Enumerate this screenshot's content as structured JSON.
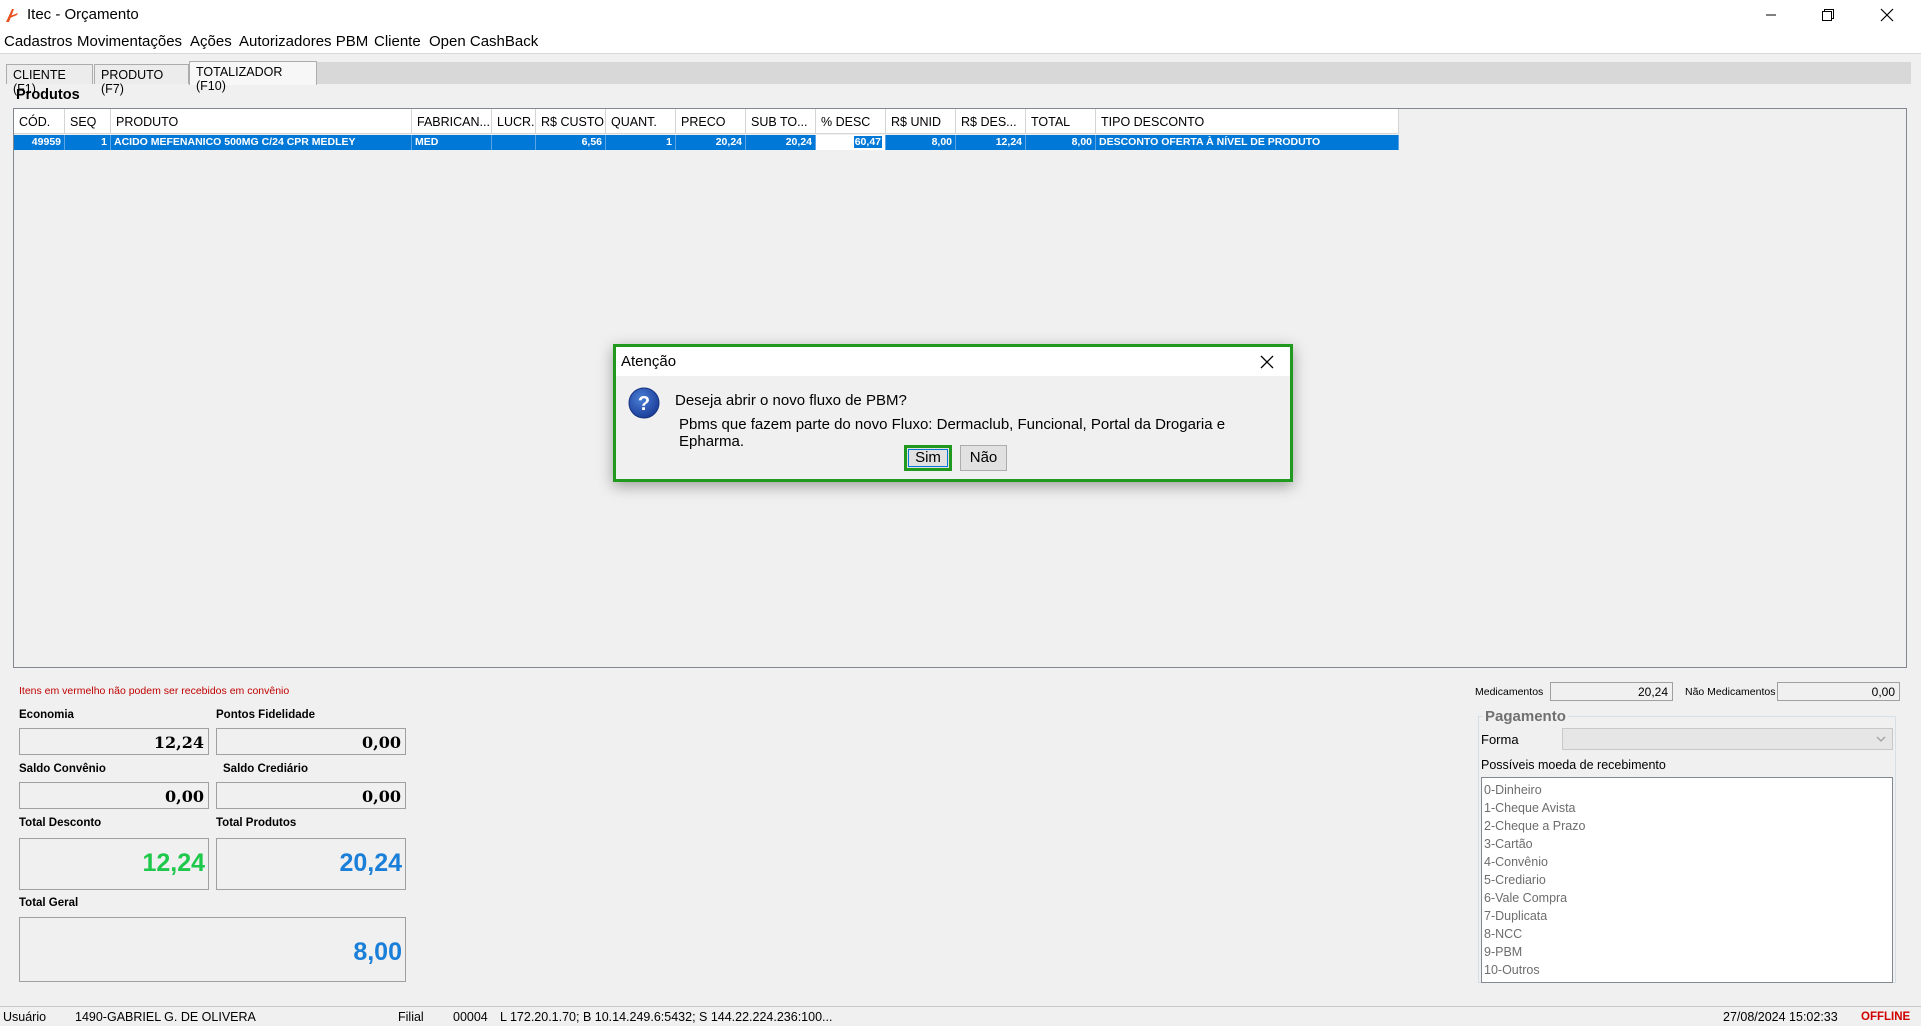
{
  "window": {
    "title": "Itec - Orçamento"
  },
  "menu": [
    "Cadastros",
    "Movimentações",
    "Ações",
    "Autorizadores PBM",
    "Cliente",
    "Open CashBack"
  ],
  "tabs": [
    "CLIENTE (F1)",
    "PRODUTO (F7)",
    "TOTALIZADOR (F10)"
  ],
  "produtos": {
    "label": "Produtos",
    "columns": [
      "CÓD.",
      "SEQ",
      "PRODUTO",
      "FABRICAN...",
      "LUCR.",
      "R$ CUSTO",
      "QUANT.",
      "PRECO",
      "SUB TO...",
      "% DESC",
      "R$ UNID",
      "R$ DES...",
      "TOTAL",
      "TIPO DESCONTO"
    ],
    "row": {
      "cod": "49959",
      "seq": "1",
      "produto": "ACIDO MEFENANICO 500MG C/24 CPR MEDLEY",
      "fabricante": "MED",
      "lucro": "",
      "custo": "6,56",
      "quant": "1",
      "preco": "20,24",
      "subtotal": "20,24",
      "desc_pct": "60,47",
      "unid": "8,00",
      "desconto": "12,24",
      "total": "8,00",
      "tipo_desconto": "DESCONTO OFERTA À NÍVEL DE PRODUTO"
    }
  },
  "resumo": {
    "aviso": "Itens em vermelho não podem ser recebidos em convênio",
    "economia_label": "Economia",
    "economia": "12,24",
    "pontos_label": "Pontos Fidelidade",
    "pontos": "0,00",
    "saldo_convenio_label": "Saldo Convênio",
    "saldo_convenio": "0,00",
    "saldo_crediario_label": "Saldo Crediário",
    "saldo_crediario": "0,00",
    "total_desconto_label": "Total Desconto",
    "total_desconto": "12,24",
    "total_produtos_label": "Total Produtos",
    "total_produtos": "20,24",
    "total_geral_label": "Total Geral",
    "total_geral": "8,00"
  },
  "pagamento": {
    "medicamentos_label": "Medicamentos",
    "medicamentos": "20,24",
    "nao_medicamentos_label": "Não Medicamentos",
    "nao_medicamentos": "0,00",
    "title": "Pagamento",
    "forma_label": "Forma",
    "possiveis_label": "Possíveis moeda de recebimento",
    "moedas": [
      "0-Dinheiro",
      "1-Cheque Avista",
      "2-Cheque a Prazo",
      "3-Cartão",
      "4-Convênio",
      "5-Crediario",
      "6-Vale Compra",
      "7-Duplicata",
      "8-NCC",
      "9-PBM",
      "10-Outros"
    ]
  },
  "status": {
    "usuario_label": "Usuário",
    "usuario": "1490-GABRIEL G. DE OLIVERA",
    "filial_label": "Filial",
    "filial": "00004",
    "conexao": "L 172.20.1.70; B 10.14.249.6:5432; S 144.22.224.236:100...",
    "datetime": "27/08/2024 15:02:33",
    "modo": "OFFLINE"
  },
  "dialog": {
    "title": "Atenção",
    "message": "Deseja abrir o novo fluxo de PBM?",
    "detail": "Pbms que fazem parte do novo Fluxo: Dermaclub, Funcional, Portal da Drogaria e Epharma.",
    "yes": "Sim",
    "no": "Não"
  },
  "colors": {
    "selection": "#0078d7",
    "green_value": "#1ec84a",
    "blue_value": "#1a7fd8",
    "offline": "#d00000",
    "dialog_border": "#1f9a1f"
  },
  "icons": {
    "app": "itec-logo-icon",
    "dialog": "question-icon"
  }
}
